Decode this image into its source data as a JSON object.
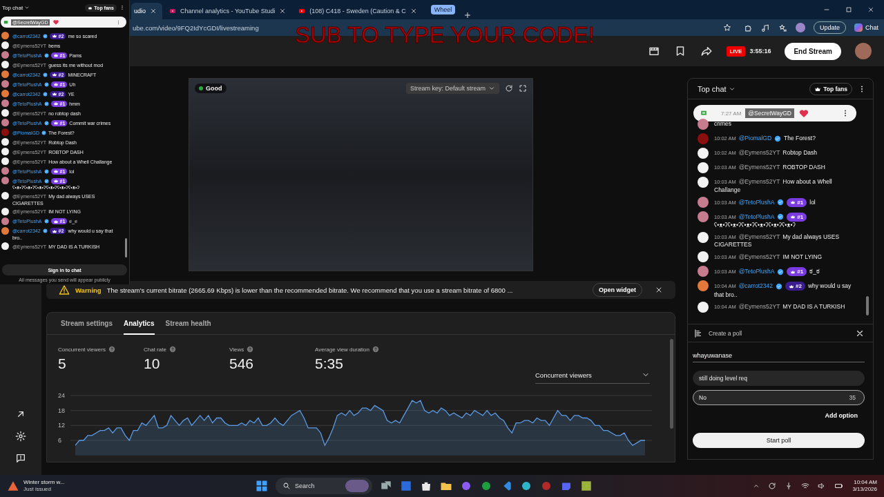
{
  "browser": {
    "tabs": [
      {
        "title": "udio",
        "selected": true
      },
      {
        "title": "Channel analytics - YouTube Studi",
        "selected": false
      },
      {
        "title": "(108) C418 - Sweden (Caution & C",
        "selected": false
      }
    ],
    "tab_group": "Wheel",
    "address": "ube.com/video/9FQ2IdYcGDI/livestreaming",
    "update_button": "Update",
    "chat_button": "Chat"
  },
  "overlay_text": "SUB TO TYPE YOUR CODE!",
  "header": {
    "live_badge": "LIVE",
    "duration": "3:55:16",
    "end_button": "End Stream"
  },
  "preview": {
    "status": "Good",
    "stream_key": "Stream key: Default stream"
  },
  "warning": {
    "label": "Warning",
    "message": "The stream's current bitrate (2665.69 Kbps) is lower than the recommended bitrate. We recommend that you use a stream bitrate of 6800 ...",
    "button": "Open widget"
  },
  "panel": {
    "tabs": [
      {
        "label": "Stream settings",
        "selected": false
      },
      {
        "label": "Analytics",
        "selected": true
      },
      {
        "label": "Stream health",
        "selected": false
      }
    ],
    "stats": [
      {
        "label": "Concurrent viewers",
        "value": "5"
      },
      {
        "label": "Chat rate",
        "value": "10"
      },
      {
        "label": "Views",
        "value": "546"
      },
      {
        "label": "Average view duration",
        "value": "5:35"
      }
    ],
    "metric_select": "Concurrent viewers",
    "chart_data": {
      "type": "area",
      "grid": true,
      "ylim": [
        0,
        24
      ],
      "yticks": [
        6,
        12,
        18,
        24
      ],
      "series": [
        {
          "color": "#5c9ce6",
          "values": [
            4,
            6,
            6,
            8,
            8,
            9,
            10,
            10,
            11,
            9,
            11,
            11,
            8,
            6,
            10,
            10,
            13,
            12,
            14,
            16,
            11,
            11,
            12,
            16,
            14,
            12,
            14,
            15,
            12,
            14,
            16,
            14,
            16,
            13,
            15,
            15,
            13,
            12,
            12,
            12,
            13,
            12,
            14,
            13,
            15,
            12,
            12,
            13,
            15,
            13,
            12,
            14,
            16,
            17,
            18,
            15,
            11,
            11,
            11,
            9,
            4,
            7,
            11,
            16,
            17,
            16,
            18,
            16,
            17,
            19,
            19,
            18,
            20,
            19,
            18,
            14,
            13,
            14,
            13,
            16,
            19,
            22,
            21,
            22,
            18,
            17,
            18,
            17,
            19,
            18,
            16,
            17,
            16,
            15,
            17,
            16,
            18,
            17,
            16,
            18,
            16,
            17,
            15,
            14,
            11,
            9,
            13,
            13,
            14,
            14,
            13,
            15,
            14,
            14,
            12,
            15,
            18,
            16,
            16,
            14,
            16,
            16,
            15,
            15,
            14,
            12,
            12,
            10,
            10,
            9,
            8,
            8,
            9,
            6,
            4,
            5,
            6,
            6
          ]
        }
      ]
    }
  },
  "live_chat": {
    "title": "Top chat",
    "top_fans": "Top fans",
    "pinned": {
      "time": "7:27 AM",
      "author": "@SecretWayGD"
    },
    "messages": [
      {
        "kind": "partial",
        "text": "crimes",
        "color": "#c77b8f"
      },
      {
        "kind": "message",
        "time": "10:02 AM",
        "author": "@PiomalGD",
        "verified": true,
        "text": "The Forest?",
        "color": "#8b0f0f"
      },
      {
        "kind": "message",
        "time": "10:02 AM",
        "author": "@Eymens52YT",
        "verified": false,
        "text": "Robtop Dash",
        "color": "#f2f2f2"
      },
      {
        "kind": "message",
        "time": "10:03 AM",
        "author": "@Eymens52YT",
        "verified": false,
        "text": "ROBTOP DASH",
        "color": "#f2f2f2"
      },
      {
        "kind": "message",
        "time": "10:03 AM",
        "author": "@Eymens52YT",
        "verified": false,
        "text": "How about a Whell Challange",
        "color": "#f2f2f2"
      },
      {
        "kind": "message",
        "time": "10:03 AM",
        "author": "@TetoPlushA",
        "verified": true,
        "badge": {
          "text": "#1",
          "color": "#7a3ce0"
        },
        "text": "lol",
        "color": "#c77b8f"
      },
      {
        "kind": "message",
        "time": "10:03 AM",
        "author": "@TetoPlushA",
        "verified": true,
        "badge": {
          "text": "#1",
          "color": "#7a3ce0"
        },
        "text": "ʕ•ᴥ•ʔʕ•ᴥ•ʔʕ•ᴥ•ʔʕ•ᴥ•ʔʕ•ᴥ•ʔʕ•ᴥ•ʔ",
        "color": "#c77b8f"
      },
      {
        "kind": "message",
        "time": "10:03 AM",
        "author": "@Eymens52YT",
        "verified": false,
        "text": "My dad always USES CIGARETTES",
        "color": "#f2f2f2"
      },
      {
        "kind": "message",
        "time": "10:03 AM",
        "author": "@Eymens52YT",
        "verified": false,
        "text": "IM NOT LYING",
        "color": "#f2f2f2"
      },
      {
        "kind": "message",
        "time": "10:03 AM",
        "author": "@TetoPlushA",
        "verified": true,
        "badge": {
          "text": "#1",
          "color": "#7a3ce0"
        },
        "text": "ಠ_ಠ",
        "color": "#c77b8f"
      },
      {
        "kind": "message",
        "time": "10:04 AM",
        "author": "@carrot2342",
        "verified": true,
        "badge": {
          "text": "#2",
          "color": "#3b1d8f"
        },
        "text": "why would u say that bro..",
        "color": "#e2793a"
      },
      {
        "kind": "message",
        "time": "10:04 AM",
        "author": "@Eymens52YT",
        "verified": false,
        "text": "MY DAD IS A TURKISH",
        "color": "#f2f2f2"
      }
    ]
  },
  "poll": {
    "title": "Create a poll",
    "question": "whayuwanase",
    "options": [
      {
        "value": "still doing level req",
        "focused": false
      },
      {
        "value": "No",
        "focused": true,
        "counter": "35"
      }
    ],
    "add_option": "Add option",
    "start_button": "Start poll"
  },
  "popout_chat": {
    "title": "Top chat",
    "top_fans": "Top fans",
    "pinned_author": "@SecretWayGD",
    "messages": [
      {
        "author": "@carrot2342",
        "verified": true,
        "badge": {
          "text": "#2",
          "color": "#3b1d8f"
        },
        "text": "me so scared",
        "color": "#e2793a"
      },
      {
        "author": "@Eymens52YT",
        "verified": false,
        "text": "bems",
        "color": "#f2f2f2"
      },
      {
        "author": "@TetoPlushA",
        "verified": true,
        "badge": {
          "text": "#1",
          "color": "#7a3ce0"
        },
        "text": "Pams",
        "color": "#c77b8f"
      },
      {
        "author": "@Eymens52YT",
        "verified": false,
        "text": "guess its me without mod",
        "color": "#f2f2f2"
      },
      {
        "author": "@carrot2342",
        "verified": true,
        "badge": {
          "text": "#2",
          "color": "#3b1d8f"
        },
        "text": "MINECRAFT",
        "color": "#e2793a"
      },
      {
        "author": "@TetoPlushA",
        "verified": true,
        "badge": {
          "text": "#1",
          "color": "#7a3ce0"
        },
        "text": "Uh",
        "color": "#c77b8f"
      },
      {
        "author": "@carrot2342",
        "verified": true,
        "badge": {
          "text": "#2",
          "color": "#3b1d8f"
        },
        "text": "YE",
        "color": "#e2793a"
      },
      {
        "author": "@TetoPlushA",
        "verified": true,
        "badge": {
          "text": "#1",
          "color": "#7a3ce0"
        },
        "text": "hmm",
        "color": "#c77b8f"
      },
      {
        "author": "@Eymens52YT",
        "verified": false,
        "text": "no robtop dash",
        "color": "#f2f2f2"
      },
      {
        "author": "@TetoPlushA",
        "verified": true,
        "badge": {
          "text": "#1",
          "color": "#7a3ce0"
        },
        "text": "Commit war crimes",
        "color": "#c77b8f"
      },
      {
        "author": "@PiomalGD",
        "verified": true,
        "text": "The Forest?",
        "color": "#8b0f0f"
      },
      {
        "author": "@Eymens52YT",
        "verified": false,
        "text": "Robtop Dash",
        "color": "#f2f2f2"
      },
      {
        "author": "@Eymens52YT",
        "verified": false,
        "text": "ROBTOP DASH",
        "color": "#f2f2f2"
      },
      {
        "author": "@Eymens52YT",
        "verified": false,
        "text": "How about a Whell Challange",
        "color": "#f2f2f2"
      },
      {
        "author": "@TetoPlushA",
        "verified": true,
        "badge": {
          "text": "#1",
          "color": "#7a3ce0"
        },
        "text": "lol",
        "color": "#c77b8f"
      },
      {
        "author": "@TetoPlushA",
        "verified": true,
        "badge": {
          "text": "#1",
          "color": "#7a3ce0"
        },
        "text": "ʕ•ᴥ•ʔʕ•ᴥ•ʔʕ•ᴥ•ʔʕ•ᴥ•ʔʕ•ᴥ•ʔʕ•ᴥ•ʔ",
        "color": "#c77b8f"
      },
      {
        "author": "@Eymens52YT",
        "verified": false,
        "text": "My dad always USES CIGARETTES",
        "color": "#f2f2f2"
      },
      {
        "author": "@Eymens52YT",
        "verified": false,
        "text": "IM NOT LYING",
        "color": "#f2f2f2"
      },
      {
        "author": "@TetoPlushA",
        "verified": true,
        "badge": {
          "text": "#1",
          "color": "#7a3ce0"
        },
        "text": "ಠ_ಠ",
        "color": "#c77b8f"
      },
      {
        "author": "@carrot2342",
        "verified": true,
        "badge": {
          "text": "#2",
          "color": "#3b1d8f"
        },
        "text": "why would u say that bro..",
        "color": "#e2793a"
      },
      {
        "author": "@Eymens52YT",
        "verified": false,
        "text": "MY DAD IS A TURKISH",
        "color": "#f2f2f2"
      }
    ],
    "sign_in_button": "Sign in to chat",
    "notice": "All messages you send will appear publicly"
  },
  "taskbar": {
    "weather_title": "Winter storm w...",
    "weather_subtitle": "Just issued",
    "search": {
      "placeholder": "Search"
    },
    "time": "10:04 AM",
    "date": "3/13/2026"
  }
}
